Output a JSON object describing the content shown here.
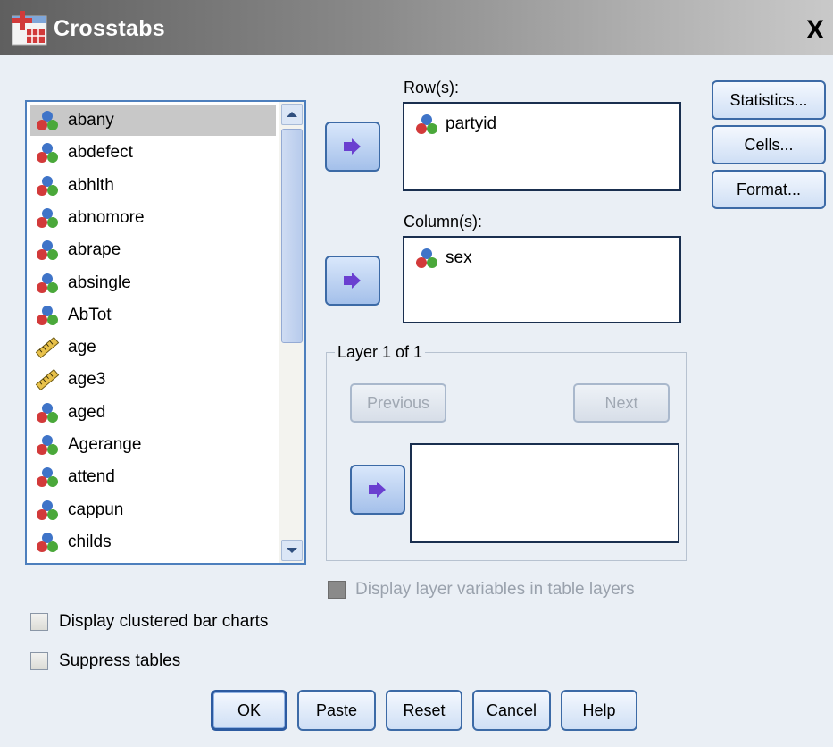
{
  "window": {
    "title": "Crosstabs",
    "close_label": "X"
  },
  "variables": {
    "items": [
      {
        "name": "abany",
        "icon": "nominal-icon",
        "selected": true
      },
      {
        "name": "abdefect",
        "icon": "nominal-icon"
      },
      {
        "name": "abhlth",
        "icon": "nominal-icon"
      },
      {
        "name": "abnomore",
        "icon": "nominal-icon"
      },
      {
        "name": "abrape",
        "icon": "nominal-icon"
      },
      {
        "name": "absingle",
        "icon": "nominal-icon"
      },
      {
        "name": "AbTot",
        "icon": "nominal-icon"
      },
      {
        "name": "age",
        "icon": "scale-icon"
      },
      {
        "name": "age3",
        "icon": "scale-icon"
      },
      {
        "name": "aged",
        "icon": "nominal-icon"
      },
      {
        "name": "Agerange",
        "icon": "nominal-icon"
      },
      {
        "name": "attend",
        "icon": "nominal-icon"
      },
      {
        "name": "cappun",
        "icon": "nominal-icon"
      },
      {
        "name": "childs",
        "icon": "nominal-icon"
      }
    ]
  },
  "rows": {
    "label": "Row(s):",
    "items": [
      "partyid"
    ]
  },
  "columns": {
    "label": "Column(s):",
    "items": [
      "sex"
    ]
  },
  "layer": {
    "label": "Layer 1 of 1",
    "previous_label": "Previous",
    "next_label": "Next"
  },
  "side_buttons": {
    "statistics": "Statistics...",
    "cells": "Cells...",
    "format": "Format..."
  },
  "options": {
    "display_layers": "Display layer variables in table layers",
    "clustered_bar": "Display clustered bar charts",
    "suppress_tables": "Suppress tables"
  },
  "buttons": {
    "ok": "OK",
    "paste": "Paste",
    "reset": "Reset",
    "cancel": "Cancel",
    "help": "Help"
  },
  "colors": {
    "title_gradient_start": "#5f5f5f",
    "button_border": "#3c6aa6",
    "selected_row": "#c8c8c8"
  }
}
